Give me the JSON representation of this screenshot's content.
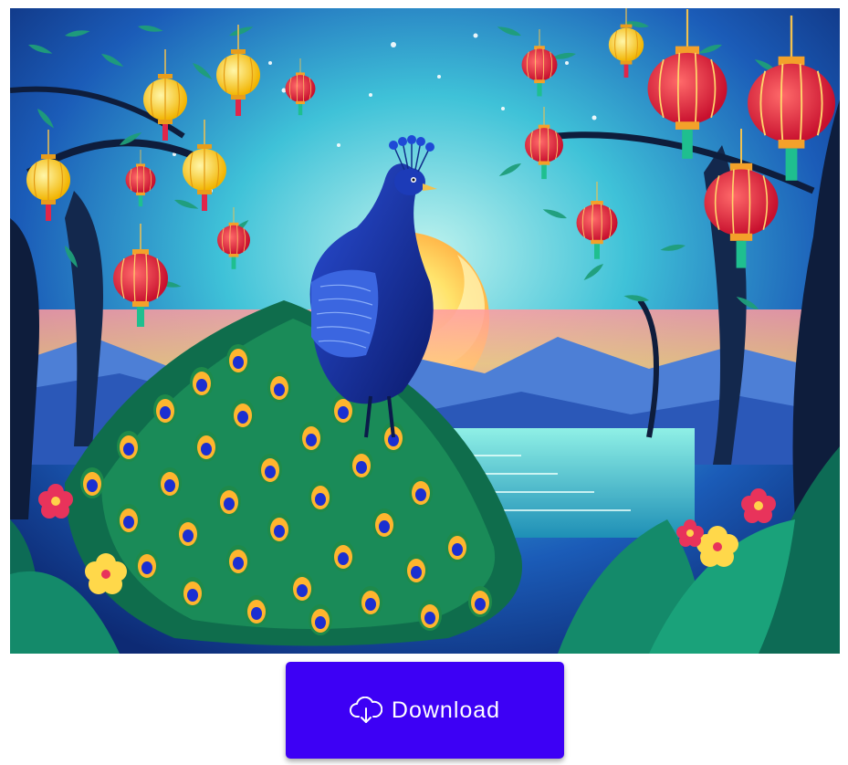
{
  "download_button": {
    "label": "Download",
    "icon": "cloud-download-icon"
  },
  "artwork": {
    "subject": "peacock-with-lanterns-painting"
  },
  "colors": {
    "button_background": "#3d00f5",
    "button_text": "#ffffff"
  }
}
